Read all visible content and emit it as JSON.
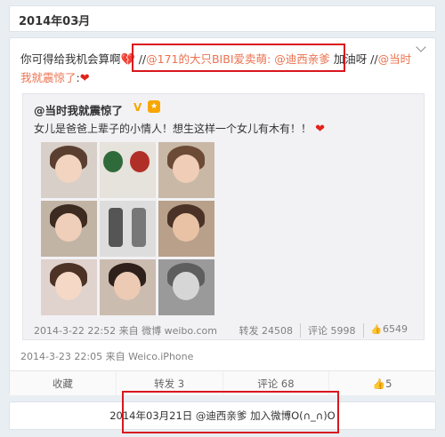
{
  "month_header": {
    "label": "2014年03月"
  },
  "post": {
    "text_prefix": "你可得给我机会算啊",
    "sep1": "//",
    "mention1": "@171的大只BIBI爱卖萌",
    "colon1": ": ",
    "mention2": "@迪西亲爹",
    "plain1": " 加油呀 ",
    "sep2": "//",
    "mention3": "@当时我就震惊了",
    "colon2": ":"
  },
  "repost": {
    "author": "@当时我就震惊了",
    "text": "女儿是爸爸上辈子的小情人！想生这样一个女儿有木有！！",
    "meta": "2014-3-22 22:52 来自 微博 weibo.com",
    "reposts": "转发 24508",
    "comments": "评论 5998",
    "likes": "6549"
  },
  "post_meta": "2014-3-23 22:05 来自 Weico.iPhone",
  "actions": {
    "favorite": "收藏",
    "repost": "转发 3",
    "comment": "评论 68",
    "like": "5"
  },
  "footer": {
    "text": "2014年03月21日 @迪西亲爹 加入微博O(∩_∩)O"
  },
  "colors": {
    "mention": "#eb7350",
    "highlight": "#d9161e",
    "background": "#e9eef2"
  }
}
